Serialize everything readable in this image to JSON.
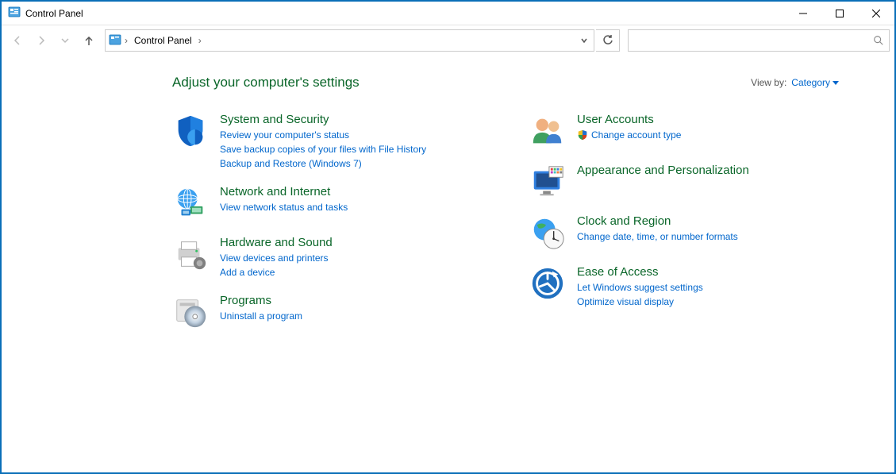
{
  "window": {
    "title": "Control Panel"
  },
  "breadcrumb": {
    "root": "Control Panel"
  },
  "page": {
    "heading": "Adjust your computer's settings"
  },
  "viewby": {
    "label": "View by:",
    "value": "Category"
  },
  "categories": {
    "system_security": {
      "title": "System and Security",
      "links": [
        "Review your computer's status",
        "Save backup copies of your files with File History",
        "Backup and Restore (Windows 7)"
      ]
    },
    "network": {
      "title": "Network and Internet",
      "links": [
        "View network status and tasks"
      ]
    },
    "hardware": {
      "title": "Hardware and Sound",
      "links": [
        "View devices and printers",
        "Add a device"
      ]
    },
    "programs": {
      "title": "Programs",
      "links": [
        "Uninstall a program"
      ]
    },
    "user_accounts": {
      "title": "User Accounts",
      "links": [
        "Change account type"
      ]
    },
    "appearance": {
      "title": "Appearance and Personalization",
      "links": []
    },
    "clock": {
      "title": "Clock and Region",
      "links": [
        "Change date, time, or number formats"
      ]
    },
    "ease": {
      "title": "Ease of Access",
      "links": [
        "Let Windows suggest settings",
        "Optimize visual display"
      ]
    }
  }
}
